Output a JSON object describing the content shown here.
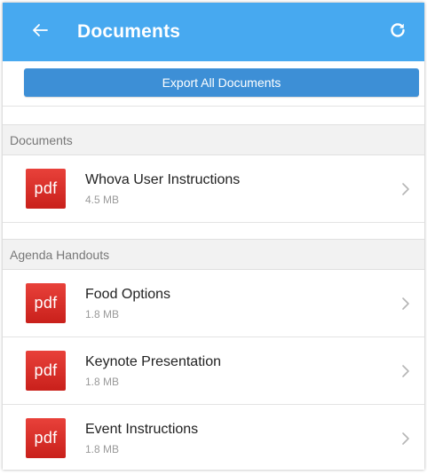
{
  "appbar": {
    "title": "Documents",
    "back_icon": "arrow-left-icon",
    "refresh_icon": "refresh-icon",
    "color": "#47a9f0"
  },
  "export": {
    "label": "Export All Documents",
    "color": "#3d8fd6"
  },
  "sections": [
    {
      "header": "Documents",
      "items": [
        {
          "icon_text": "pdf",
          "name": "Whova User Instructions",
          "size": "4.5 MB"
        }
      ]
    },
    {
      "header": "Agenda Handouts",
      "items": [
        {
          "icon_text": "pdf",
          "name": "Food Options",
          "size": "1.8 MB"
        },
        {
          "icon_text": "pdf",
          "name": "Keynote Presentation",
          "size": "1.8 MB"
        },
        {
          "icon_text": "pdf",
          "name": "Event Instructions",
          "size": "1.8 MB"
        }
      ]
    }
  ],
  "colors": {
    "pdf_red": "#d42c25",
    "section_header_bg": "#f2f2f2"
  }
}
